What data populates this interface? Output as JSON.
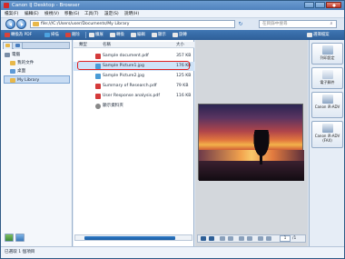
{
  "window": {
    "title": "Canon IJ Desktop - Browser"
  },
  "menu": [
    "檔案(F)",
    "編輯(E)",
    "檢視(V)",
    "移動(G)",
    "工具(T)",
    "設定(S)",
    "說明(H)"
  ],
  "address": {
    "path": "file:///C:/Users/user/Documents/My Library",
    "search_placeholder": "在目錄中搜尋"
  },
  "toolbar": {
    "items": [
      "轉換為 PDF",
      "掃描",
      "刪除",
      "擴展",
      "轉換",
      "編輯",
      "顯示",
      "旋轉",
      "選擇檔案"
    ],
    "colors": [
      "#d9433b",
      "#4da3e0",
      "#d9433b",
      "#e8e8e8",
      "#e8e8e8",
      "#e8e8e8",
      "#e8e8e8",
      "#e8e8e8",
      "#e8e8e8"
    ]
  },
  "tree": {
    "header": "電腦",
    "items": [
      {
        "label": "電腦",
        "color": "#7a8ea8",
        "indent": 0,
        "selected": false
      },
      {
        "label": "我的文件",
        "color": "#e8b84a",
        "indent": 1,
        "selected": false
      },
      {
        "label": "桌面",
        "color": "#5d9ad6",
        "indent": 1,
        "selected": false
      },
      {
        "label": "My Library",
        "color": "#e8b84a",
        "indent": 1,
        "selected": true
      }
    ]
  },
  "filelist": {
    "columns": {
      "type": "類型",
      "name": "名稱",
      "size": "大小"
    },
    "rows": [
      {
        "name": "Sample document.pdf",
        "size": "357 KB",
        "icon": "#d43b3b",
        "highlight": false
      },
      {
        "name": "Sample Picture1.jpg",
        "size": "176 KB",
        "icon": "#4a9bd6",
        "highlight": true
      },
      {
        "name": "Sample Picture2.jpg",
        "size": "125 KB",
        "icon": "#4a9bd6",
        "highlight": false
      },
      {
        "name": "Summary of Research.pdf",
        "size": "79 KB",
        "icon": "#d43b3b",
        "highlight": false
      },
      {
        "name": "User Response analysis.pdf",
        "size": "116 KB",
        "icon": "#d43b3b",
        "highlight": false
      },
      {
        "name": "顯示資料夾",
        "size": "",
        "icon": "#888888",
        "highlight": false
      }
    ]
  },
  "preview": {
    "page": "1",
    "total": "/1"
  },
  "rightpanel": {
    "buttons": [
      {
        "label": "列印設定",
        "color": "#4e7fb8"
      },
      {
        "label": "電子郵件",
        "color": "#4e7fb8"
      },
      {
        "label": "Canon iR-ADV",
        "color": "#4e7fb8"
      },
      {
        "label": "Canon iR-ADV (FAX)",
        "color": "#4e7fb8"
      }
    ]
  },
  "status": {
    "text": "已選取 1 個項目"
  }
}
